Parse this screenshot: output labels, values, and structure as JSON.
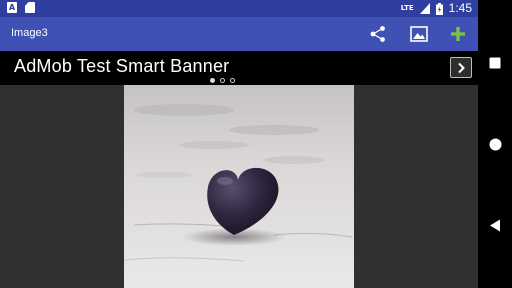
{
  "status_bar": {
    "notification_icons": [
      "A",
      ""
    ],
    "network": "LTE",
    "time": "1:45"
  },
  "toolbar": {
    "title": "Image3",
    "actions": [
      "share-icon",
      "image-icon",
      "add-icon"
    ],
    "accent": "#3f51b5",
    "add_color": "#76c442"
  },
  "ad_banner": {
    "text": "AdMob Test Smart Banner",
    "page_count": 3,
    "active_page": 1
  },
  "image": {
    "description_icon": "heart-photo"
  },
  "navigation": {
    "buttons": [
      "recents-icon",
      "home-icon",
      "back-icon"
    ]
  }
}
